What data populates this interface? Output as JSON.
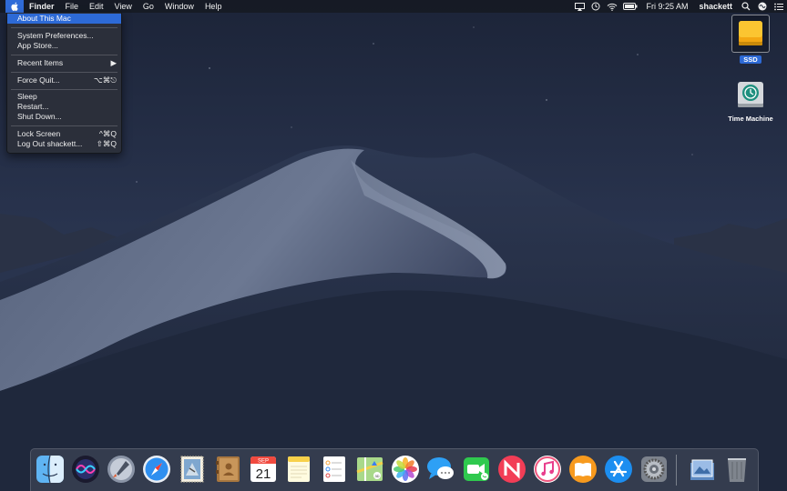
{
  "menubar": {
    "app_name": "Finder",
    "menus": [
      "File",
      "Edit",
      "View",
      "Go",
      "Window",
      "Help"
    ],
    "clock": "Fri 9:25 AM",
    "user": "shackett"
  },
  "apple_menu": {
    "about": "About This Mac",
    "system_prefs": "System Preferences...",
    "app_store": "App Store...",
    "recent_items": "Recent Items",
    "force_quit": "Force Quit...",
    "force_quit_shortcut": "⌥⌘⎋",
    "sleep": "Sleep",
    "restart": "Restart...",
    "shut_down": "Shut Down...",
    "lock_screen": "Lock Screen",
    "lock_screen_shortcut": "^⌘Q",
    "log_out": "Log Out shackett...",
    "log_out_shortcut": "⇧⌘Q"
  },
  "desktop_icons": {
    "ssd": "SSD",
    "time_machine": "Time Machine"
  },
  "dock": {
    "apps": [
      "Finder",
      "Siri",
      "Launchpad",
      "Safari",
      "Mail",
      "Contacts",
      "Calendar",
      "Notes",
      "Reminders",
      "Maps",
      "Photos",
      "Messages",
      "FaceTime",
      "News",
      "iTunes",
      "Books",
      "App Store",
      "System Preferences",
      "Downloads",
      "Trash"
    ],
    "calendar_month": "SEP",
    "calendar_day": "21"
  },
  "colors": {
    "selection": "#2d6ad6",
    "menubar": "#161a24"
  }
}
